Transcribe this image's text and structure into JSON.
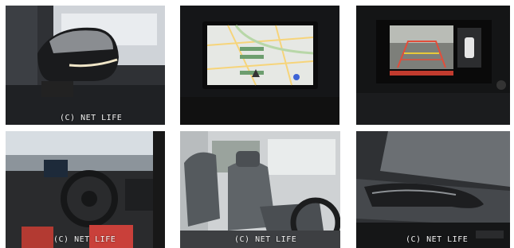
{
  "gallery": {
    "photos": [
      {
        "subject": "side-mirror",
        "watermark": "(C) NET LIFE"
      },
      {
        "subject": "navigation-screen",
        "watermark": ""
      },
      {
        "subject": "backup-camera-screen",
        "watermark": ""
      },
      {
        "subject": "dashboard-steering-wheel",
        "watermark": "(C) NET LIFE"
      },
      {
        "subject": "front-seats",
        "watermark": "(C) NET LIFE"
      },
      {
        "subject": "seat-side-detail",
        "watermark": "(C) NET LIFE"
      }
    ]
  }
}
